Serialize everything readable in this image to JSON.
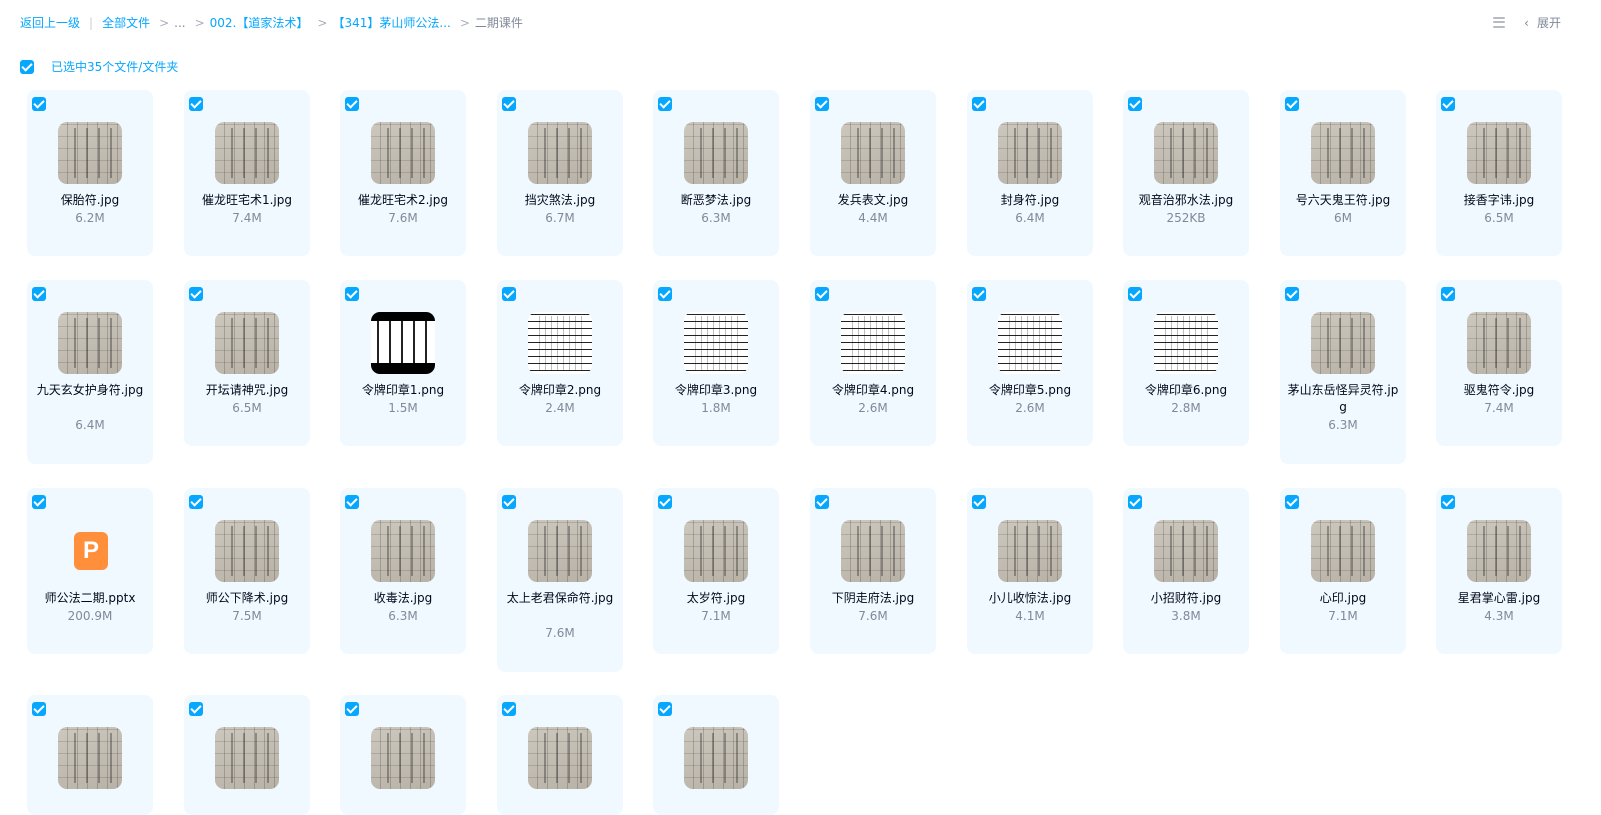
{
  "breadcrumb": {
    "back": "返回上一级",
    "all_files": "全部文件",
    "ellipsis": "...",
    "level1": "002.【道家法术】",
    "level2": "【341】茅山师公法...",
    "current": "二期课件",
    "separator": ">",
    "pipe": "|"
  },
  "top_right": {
    "expand_label": "展开",
    "icons": [
      "list-view-icon",
      "chevron-left-icon"
    ]
  },
  "selection": {
    "label": "已选中35个文件/文件夹"
  },
  "colors": {
    "accent": "#06a7ff",
    "card_bg": "#f0f9ff",
    "muted_text": "#818999",
    "ppt": "#ff8f3a"
  },
  "files": [
    {
      "name": "保胎符.jpg",
      "size": "6.2M",
      "thumb": "paper"
    },
    {
      "name": "催龙旺宅术1.jpg",
      "size": "7.4M",
      "thumb": "paper"
    },
    {
      "name": "催龙旺宅术2.jpg",
      "size": "7.6M",
      "thumb": "paper"
    },
    {
      "name": "挡灾煞法.jpg",
      "size": "6.7M",
      "thumb": "paper"
    },
    {
      "name": "断恶梦法.jpg",
      "size": "6.3M",
      "thumb": "paper"
    },
    {
      "name": "发兵表文.jpg",
      "size": "4.4M",
      "thumb": "paper"
    },
    {
      "name": "封身符.jpg",
      "size": "6.4M",
      "thumb": "paper"
    },
    {
      "name": "观音治邪水法.jpg",
      "size": "252KB",
      "thumb": "paper"
    },
    {
      "name": "号六天鬼王符.jpg",
      "size": "6M",
      "thumb": "paper"
    },
    {
      "name": "接香字讳.jpg",
      "size": "6.5M",
      "thumb": "paper"
    },
    {
      "name": "九天玄女护身符.jpg",
      "size": "6.4M",
      "thumb": "paper"
    },
    {
      "name": "开坛请神咒.jpg",
      "size": "6.5M",
      "thumb": "paper"
    },
    {
      "name": "令牌印章1.png",
      "size": "1.5M",
      "thumb": "bw-dark"
    },
    {
      "name": "令牌印章2.png",
      "size": "2.4M",
      "thumb": "bw"
    },
    {
      "name": "令牌印章3.png",
      "size": "1.8M",
      "thumb": "bw"
    },
    {
      "name": "令牌印章4.png",
      "size": "2.6M",
      "thumb": "bw"
    },
    {
      "name": "令牌印章5.png",
      "size": "2.6M",
      "thumb": "bw"
    },
    {
      "name": "令牌印章6.png",
      "size": "2.8M",
      "thumb": "bw"
    },
    {
      "name": "茅山东岳怪异灵符.jpg",
      "size": "6.3M",
      "thumb": "paper"
    },
    {
      "name": "驱鬼符令.jpg",
      "size": "7.4M",
      "thumb": "paper"
    },
    {
      "name": "师公法二期.pptx",
      "size": "200.9M",
      "thumb": "ppt"
    },
    {
      "name": "师公下降术.jpg",
      "size": "7.5M",
      "thumb": "paper"
    },
    {
      "name": "收毒法.jpg",
      "size": "6.3M",
      "thumb": "paper"
    },
    {
      "name": "太上老君保命符.jpg",
      "size": "7.6M",
      "thumb": "paper"
    },
    {
      "name": "太岁符.jpg",
      "size": "7.1M",
      "thumb": "paper"
    },
    {
      "name": "下阴走府法.jpg",
      "size": "7.6M",
      "thumb": "paper"
    },
    {
      "name": "小儿收惊法.jpg",
      "size": "4.1M",
      "thumb": "paper"
    },
    {
      "name": "小招财符.jpg",
      "size": "3.8M",
      "thumb": "paper"
    },
    {
      "name": "心印.jpg",
      "size": "7.1M",
      "thumb": "paper"
    },
    {
      "name": "星君掌心雷.jpg",
      "size": "4.3M",
      "thumb": "paper"
    },
    {
      "name": "",
      "size": "",
      "thumb": "paper"
    },
    {
      "name": "",
      "size": "",
      "thumb": "paper"
    },
    {
      "name": "",
      "size": "",
      "thumb": "paper"
    },
    {
      "name": "",
      "size": "",
      "thumb": "paper"
    },
    {
      "name": "",
      "size": "",
      "thumb": "paper"
    }
  ],
  "ppt_icon_letter": "P"
}
